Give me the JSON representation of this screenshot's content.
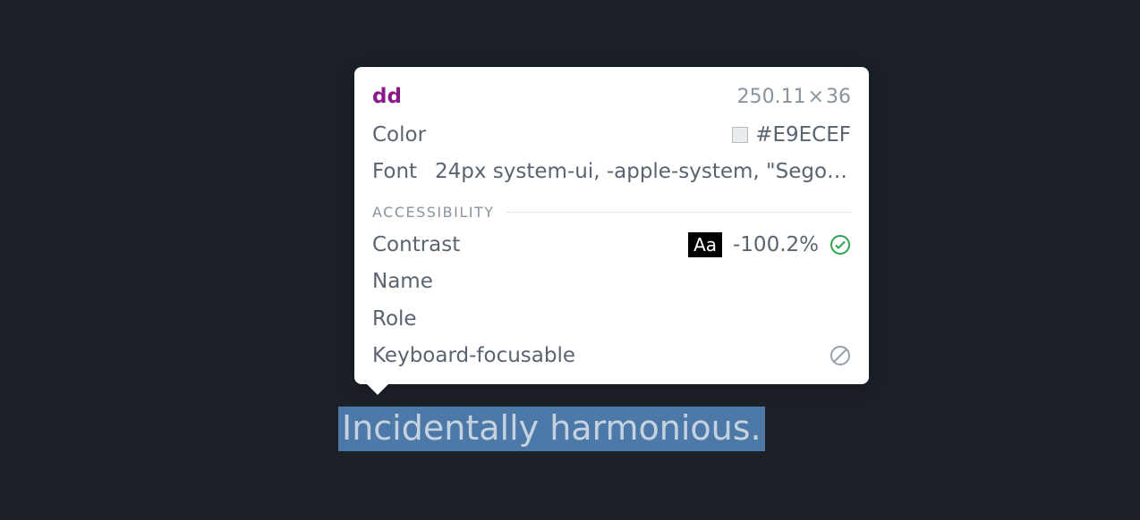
{
  "highlighted_text": "Incidentally harmonious.",
  "tooltip": {
    "tag": "dd",
    "dimensions_w": "250.11",
    "dimensions_h": "36",
    "color_label": "Color",
    "color_value": "#E9ECEF",
    "font_label": "Font",
    "font_value": "24px system-ui, -apple-system, \"Segoe…",
    "accessibility_header": "ACCESSIBILITY",
    "contrast_label": "Contrast",
    "contrast_badge": "Aa",
    "contrast_value": "-100.2%",
    "name_label": "Name",
    "role_label": "Role",
    "keyboard_focusable_label": "Keyboard-focusable"
  }
}
